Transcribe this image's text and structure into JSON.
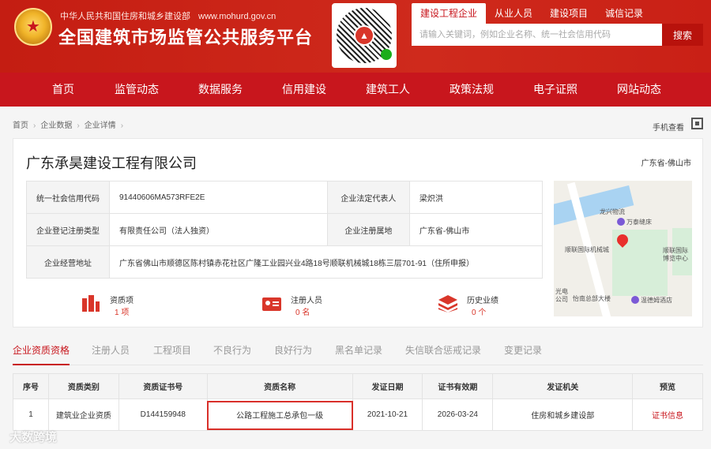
{
  "header": {
    "subtitle": "中华人民共和国住房和城乡建设部",
    "url": "www.mohurd.gov.cn",
    "title": "全国建筑市场监管公共服务平台"
  },
  "search": {
    "tabs": [
      "建设工程企业",
      "从业人员",
      "建设项目",
      "诚信记录"
    ],
    "active_tab": 0,
    "placeholder": "请输入关键词，例如企业名称、统一社会信用代码",
    "button": "搜索"
  },
  "nav": [
    "首页",
    "监管动态",
    "数据服务",
    "信用建设",
    "建筑工人",
    "政策法规",
    "电子证照",
    "网站动态"
  ],
  "breadcrumb": [
    "首页",
    "企业数据",
    "企业详情"
  ],
  "phone_view": "手机查看",
  "company": {
    "name": "广东承昊建设工程有限公司",
    "region": "广东省-佛山市",
    "info": {
      "credit_code_label": "统一社会信用代码",
      "credit_code": "91440606MA573RFE2E",
      "legal_rep_label": "企业法定代表人",
      "legal_rep": "梁炽洪",
      "reg_type_label": "企业登记注册类型",
      "reg_type": "有限责任公司（法人独资）",
      "reg_place_label": "企业注册属地",
      "reg_place": "广东省-佛山市",
      "address_label": "企业经营地址",
      "address": "广东省佛山市顺德区陈村镇赤花社区广隆工业园兴业4路18号顺联机械城18栋三层701-91（住所申报）"
    },
    "map_labels": [
      "龙兴物流",
      "万泰缝床",
      "顺联国际机械城",
      "顺联国际博览中心",
      "怡南总部大楼",
      "温德姆酒店",
      "光电公司"
    ],
    "stats": [
      {
        "label": "资质项",
        "value": "1 项",
        "icon": "building-icon"
      },
      {
        "label": "注册人员",
        "value": "0 名",
        "icon": "id-card-icon"
      },
      {
        "label": "历史业绩",
        "value": "0 个",
        "icon": "layers-icon"
      }
    ]
  },
  "tabs": [
    "企业资质资格",
    "注册人员",
    "工程项目",
    "不良行为",
    "良好行为",
    "黑名单记录",
    "失信联合惩戒记录",
    "变更记录"
  ],
  "active_tab": 0,
  "table": {
    "headers": [
      "序号",
      "资质类别",
      "资质证书号",
      "资质名称",
      "发证日期",
      "证书有效期",
      "发证机关",
      "预览"
    ],
    "rows": [
      [
        "1",
        "建筑业企业资质",
        "D144159948",
        "公路工程施工总承包一级",
        "2021-10-21",
        "2026-03-24",
        "住房和城乡建设部",
        "证书信息"
      ]
    ]
  },
  "watermark": "大数跨境",
  "colors": {
    "brand_red": "#c8161d",
    "header_red": "#c41d12"
  }
}
